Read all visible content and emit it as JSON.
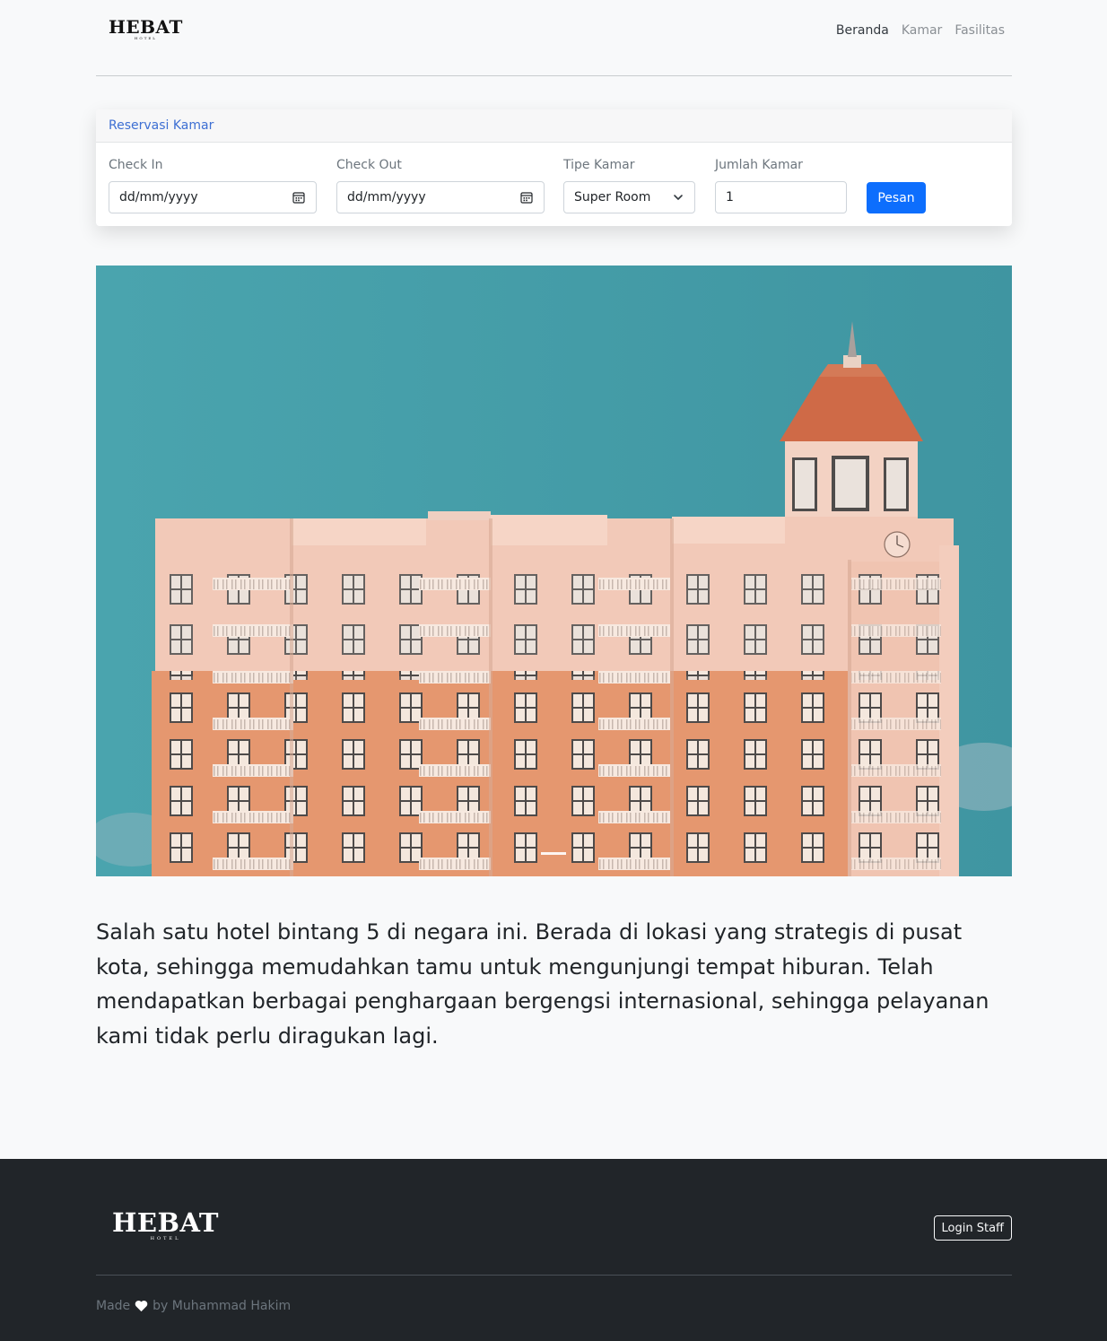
{
  "brand": {
    "name": "HEBAT",
    "tagline": "HOTEL"
  },
  "nav": {
    "items": [
      {
        "label": "Beranda",
        "active": true
      },
      {
        "label": "Kamar",
        "active": false
      },
      {
        "label": "Fasilitas",
        "active": false
      }
    ]
  },
  "reservation": {
    "title": "Reservasi Kamar",
    "check_in": {
      "label": "Check In",
      "placeholder": "dd/mm/yyyy"
    },
    "check_out": {
      "label": "Check Out",
      "placeholder": "dd/mm/yyyy"
    },
    "room_type": {
      "label": "Tipe Kamar",
      "selected": "Super Room"
    },
    "room_count": {
      "label": "Jumlah Kamar",
      "value": "1"
    },
    "submit_label": "Pesan"
  },
  "hero": {
    "carousel_active_index": 0
  },
  "description": "Salah satu hotel bintang 5 di negara ini. Berada di lokasi yang strategis di pusat kota, sehingga memudahkan tamu untuk mengunjungi tempat hiburan. Telah mendapatkan berbagai penghargaan bergengsi internasional, sehingga pelayanan kami tidak perlu diragukan lagi.",
  "footer": {
    "login_label": "Login Staff",
    "credit_prefix": "Made",
    "credit_suffix": "by Muhammad Hakim"
  },
  "colors": {
    "primary": "#0d6efd",
    "link": "#3d6fd3",
    "footer_bg": "#212529",
    "sky": "#4aa3ad",
    "facade_orange": "#e59a74",
    "facade_pink": "#f2c9b8",
    "roof_red": "#cf6a47"
  },
  "icons": {
    "date": "calendar-icon",
    "select": "chevron-down-icon",
    "credit": "heart-icon"
  }
}
